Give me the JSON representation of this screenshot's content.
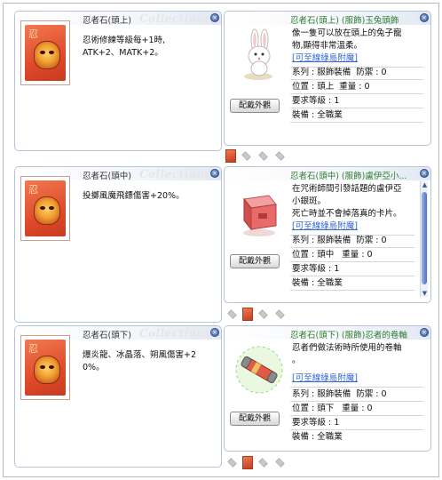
{
  "watermark": "Collections",
  "rows": [
    {
      "card_name": "忍者石(頭上)",
      "card_desc": [
        "忍術修練等級每+1時,",
        "ATK+2、MATK+2。"
      ],
      "equip_title": "忍者石(頭上) (服飾)玉兔頭飾",
      "equip_desc": [
        "像一隻可以放在頭上的兔子寵",
        "物,顯得非常溫柔。"
      ],
      "link": "[可至線綠島附魔]",
      "stats": [
        "系列 : 服飾裝備  防禦 : 0",
        "位置 : 頭上  重量 : 0",
        "要求等級 : 1",
        "裝備 : 全職業"
      ],
      "button": "配戴外觀"
    },
    {
      "card_name": "忍者石(頭中)",
      "card_desc": [
        "投擲風魔飛鏢傷害+20%。"
      ],
      "equip_title": "忍者石(頭中) (服飾)盧伊亞小...",
      "equip_desc": [
        "在咒術師間引發話題的盧伊亞",
        "小銀斑。",
        "死亡時並不會掉落真的卡片。"
      ],
      "link": "[可至線綠島附魔]",
      "stats": [
        "系列 : 服飾裝備  防禦 : 0",
        "位置 : 頭中   重量 : 0",
        "要求等級 : 1",
        "裝備 : 全職業"
      ],
      "button": "配戴外觀"
    },
    {
      "card_name": "忍者石(頭下)",
      "card_desc": [
        "爆炎龍、冰晶落、朔風傷害+2",
        "0%。"
      ],
      "equip_title": "忍者石(頭下) (服飾)忍者的卷軸",
      "equip_desc": [
        "忍者們做法術時所使用的卷軸",
        "。"
      ],
      "link": "[可至線綠島附魔]",
      "stats": [
        "系列 : 服飾裝備  防禦 : 0",
        "位置 : 頭下   重量 : 0",
        "要求等級 : 1",
        "裝備 : 全職業"
      ],
      "button": "配戴外觀"
    }
  ],
  "icons": {
    "close": "close-icon",
    "card_art": "card-illustration",
    "rabbit": "rabbit-headgear-icon",
    "block": "red-block-icon",
    "scroll": "scroll-item-icon"
  },
  "colors": {
    "equip_title": "#2e7d2e",
    "link": "#3366cc",
    "card_red": "#e04a2a"
  }
}
